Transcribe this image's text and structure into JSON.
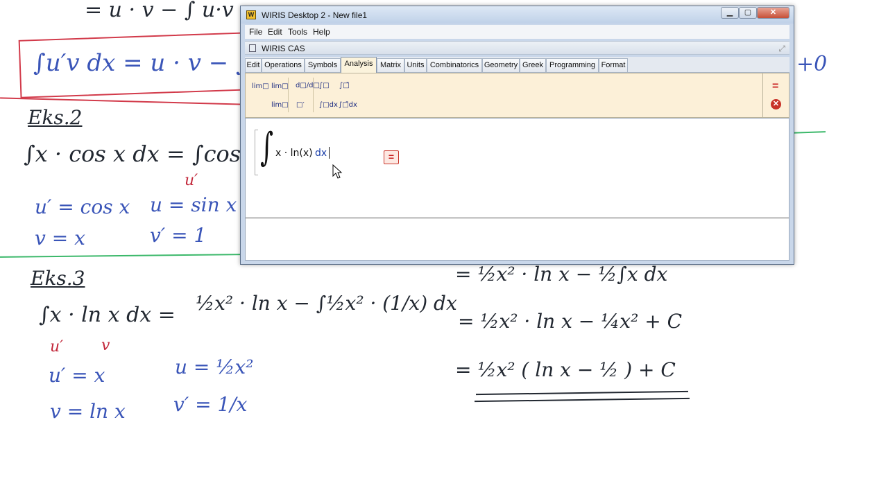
{
  "whiteboard": {
    "top_fragment": "= u · v − ∫ u·v",
    "box_formula": "∫u′v dx = u · v − ∫u",
    "plus_zero": "+0",
    "ex2": {
      "heading": "Eks.2",
      "formula": "∫x · cos x dx = ∫cos x ·",
      "under_label": "u′",
      "row1_left": "u′ = cos x",
      "row1_right": "u = sin x",
      "row2_left": "v = x",
      "row2_right": "v′ = 1"
    },
    "ex3": {
      "heading": "Eks.3",
      "main_lhs": "∫x · ln x dx =",
      "main_mid": "½x² · ln x − ∫½x² · (1/x) dx",
      "main_rhs": "= ½x² · ln x − ½∫x dx",
      "label_u": "u′",
      "label_v": "v",
      "line2": "= ½x² · ln x − ¼x² + C",
      "line3": "= ½x² ( ln x − ½ ) + C",
      "sub1_left": "u′ = x",
      "sub1_right": "u = ½x²",
      "sub2_left": "v = ln x",
      "sub2_right": "v′ = 1/x"
    },
    "colors": {
      "dark": "#222831",
      "blue": "#3a55b8",
      "red": "#c2273a",
      "green": "#3bb86a"
    }
  },
  "window": {
    "title": "WIRIS Desktop 2 - New file1",
    "app_icon": "wiris-app-icon",
    "controls": {
      "minimize": "▁",
      "maximize": "▢",
      "close": "✕"
    },
    "menu": [
      "File",
      "Edit",
      "Tools",
      "Help"
    ],
    "panel_title": "WIRIS CAS",
    "tabs": [
      "Edit",
      "Operations",
      "Symbols",
      "Analysis",
      "Matrix",
      "Units",
      "Combinatorics",
      "Geometry",
      "Greek",
      "Programming",
      "Format"
    ],
    "active_tab": "Analysis",
    "toolbar": {
      "limit_1": "lim□",
      "limit_2": "lim□",
      "limit_3": "lim□",
      "derivative_1": "d□/d□",
      "derivative_2": "□′",
      "integral_1": "∫□",
      "integral_2": "∫□̄",
      "integral_3": "∫□dx",
      "integral_4": "∫□̄dx"
    },
    "side_tools": {
      "evaluate": "=",
      "clear": "✕"
    },
    "expression": {
      "integral_symbol": "∫",
      "integrand": "x · ln(x)",
      "differential": "dx",
      "calc_button": "="
    }
  }
}
